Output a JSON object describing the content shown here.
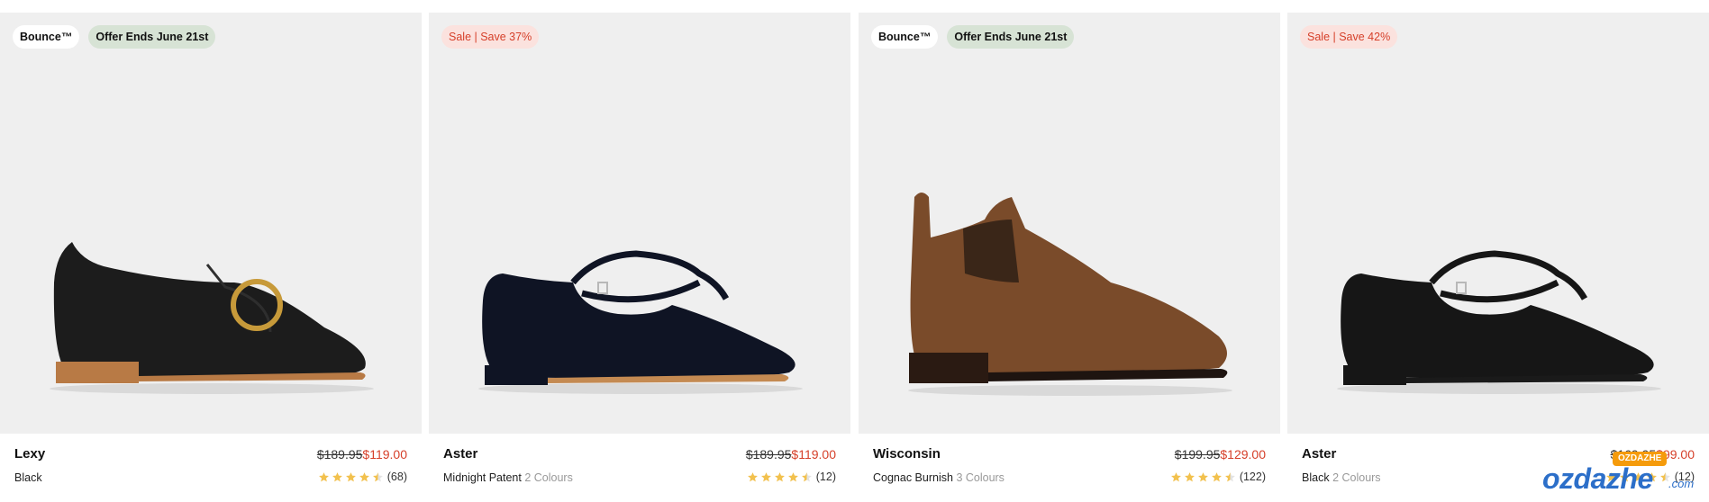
{
  "products": [
    {
      "badges": [
        {
          "label": "Bounce™",
          "style": "white"
        },
        {
          "label": "Offer Ends June 21st",
          "style": "green"
        }
      ],
      "name": "Lexy",
      "was_price": "$189.95",
      "now_price": "$119.00",
      "color": "Black",
      "colours": "",
      "rating_stars": 4.5,
      "review_count": "(68)",
      "shoe_color": "#1c1c1c",
      "sole_color": "#b87a45",
      "type": "loafer"
    },
    {
      "badges": [
        {
          "label": "Sale | Save 37%",
          "style": "sale"
        }
      ],
      "name": "Aster",
      "was_price": "$189.95",
      "now_price": "$119.00",
      "color": "Midnight Patent",
      "colours": "2 Colours",
      "rating_stars": 4.5,
      "review_count": "(12)",
      "shoe_color": "#0f1424",
      "sole_color": "#c48a52",
      "type": "maryjane"
    },
    {
      "badges": [
        {
          "label": "Bounce™",
          "style": "white"
        },
        {
          "label": "Offer Ends June 21st",
          "style": "green"
        }
      ],
      "name": "Wisconsin",
      "was_price": "$199.95",
      "now_price": "$129.00",
      "color": "Cognac Burnish",
      "colours": "3 Colours",
      "rating_stars": 4.5,
      "review_count": "(122)",
      "shoe_color": "#7a4b2a",
      "sole_color": "#2a1a12",
      "type": "boot"
    },
    {
      "badges": [
        {
          "label": "Sale | Save 42%",
          "style": "sale"
        }
      ],
      "name": "Aster",
      "was_price": "$169.95",
      "now_price": "$99.00",
      "color": "Black",
      "colours": "2 Colours",
      "rating_stars": 4.5,
      "review_count": "(12)",
      "shoe_color": "#161616",
      "sole_color": "#1a1a1a",
      "type": "maryjane"
    }
  ],
  "watermark": {
    "brand": "ozdazhe",
    "suffix": ".com",
    "badge": "OZDAZHE"
  },
  "colors": {
    "sale_red": "#d6402a",
    "star": "#f2c14e",
    "card_bg": "#efefef"
  }
}
